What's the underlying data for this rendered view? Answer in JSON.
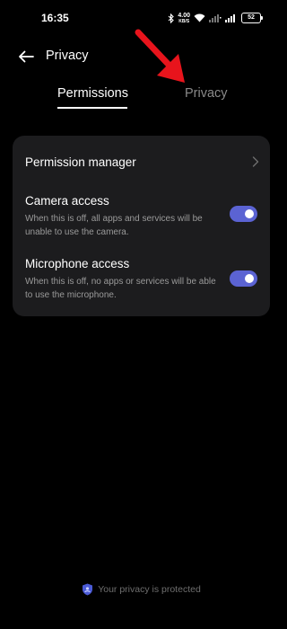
{
  "status_bar": {
    "time": "16:35",
    "net_speed_value": "4.00",
    "net_speed_unit": "KB/S",
    "battery": "52"
  },
  "header": {
    "title": "Privacy"
  },
  "tabs": [
    {
      "label": "Permissions",
      "active": true
    },
    {
      "label": "Privacy",
      "active": false
    }
  ],
  "settings": {
    "permission_manager": {
      "label": "Permission manager"
    },
    "camera": {
      "label": "Camera access",
      "description": "When this is off, all apps and services will be unable to use the camera.",
      "enabled": true
    },
    "microphone": {
      "label": "Microphone access",
      "description": "When this is off, no apps or services will be able to use the microphone.",
      "enabled": true
    }
  },
  "footer": {
    "text": "Your privacy is protected"
  },
  "colors": {
    "background": "#000000",
    "card": "#1c1c1e",
    "toggle_on": "#5b63d3",
    "annotation_arrow": "#e8141c",
    "shield": "#4a5ad6"
  },
  "icons": {
    "back": "arrow-left-icon",
    "chevron": "chevron-right-icon",
    "footer": "shield-icon",
    "annotation": "red-arrow-icon"
  }
}
